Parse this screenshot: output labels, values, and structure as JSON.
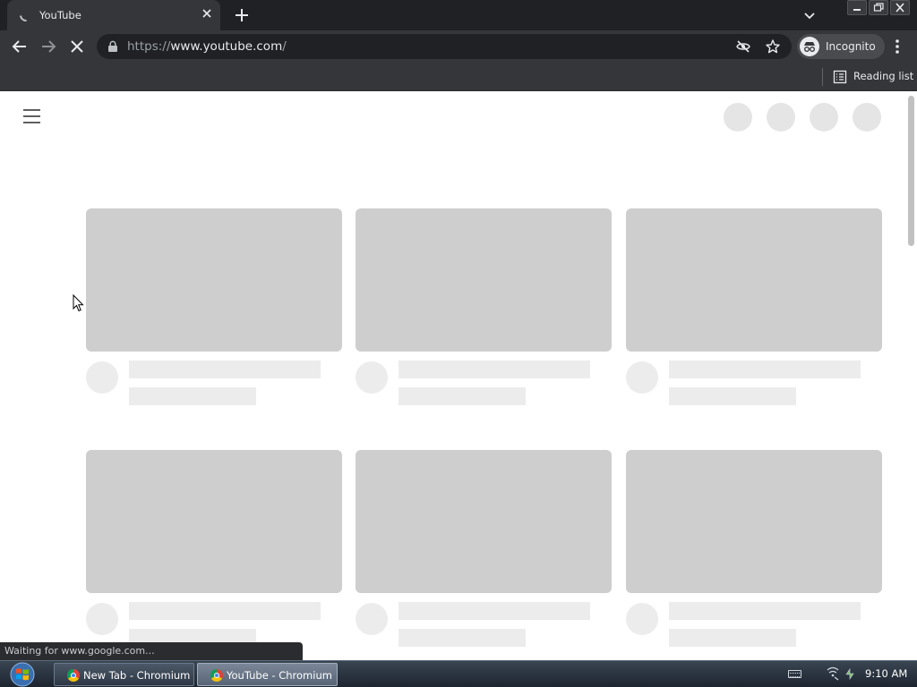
{
  "browser": {
    "tab": {
      "title": "YouTube",
      "close_icon": "close-icon"
    },
    "url": {
      "scheme": "https://",
      "host": "www.youtube.com",
      "path": "/"
    },
    "profile_label": "Incognito",
    "reading_list_label": "Reading list"
  },
  "page": {
    "status_text": "Waiting for www.google.com...",
    "placeholder_color": "#cecece",
    "skeleton_color": "#ececec"
  },
  "taskbar": {
    "tasks": [
      {
        "label": "New Tab - Chromium"
      },
      {
        "label": "YouTube - Chromium"
      }
    ],
    "clock": "9:10 AM"
  }
}
